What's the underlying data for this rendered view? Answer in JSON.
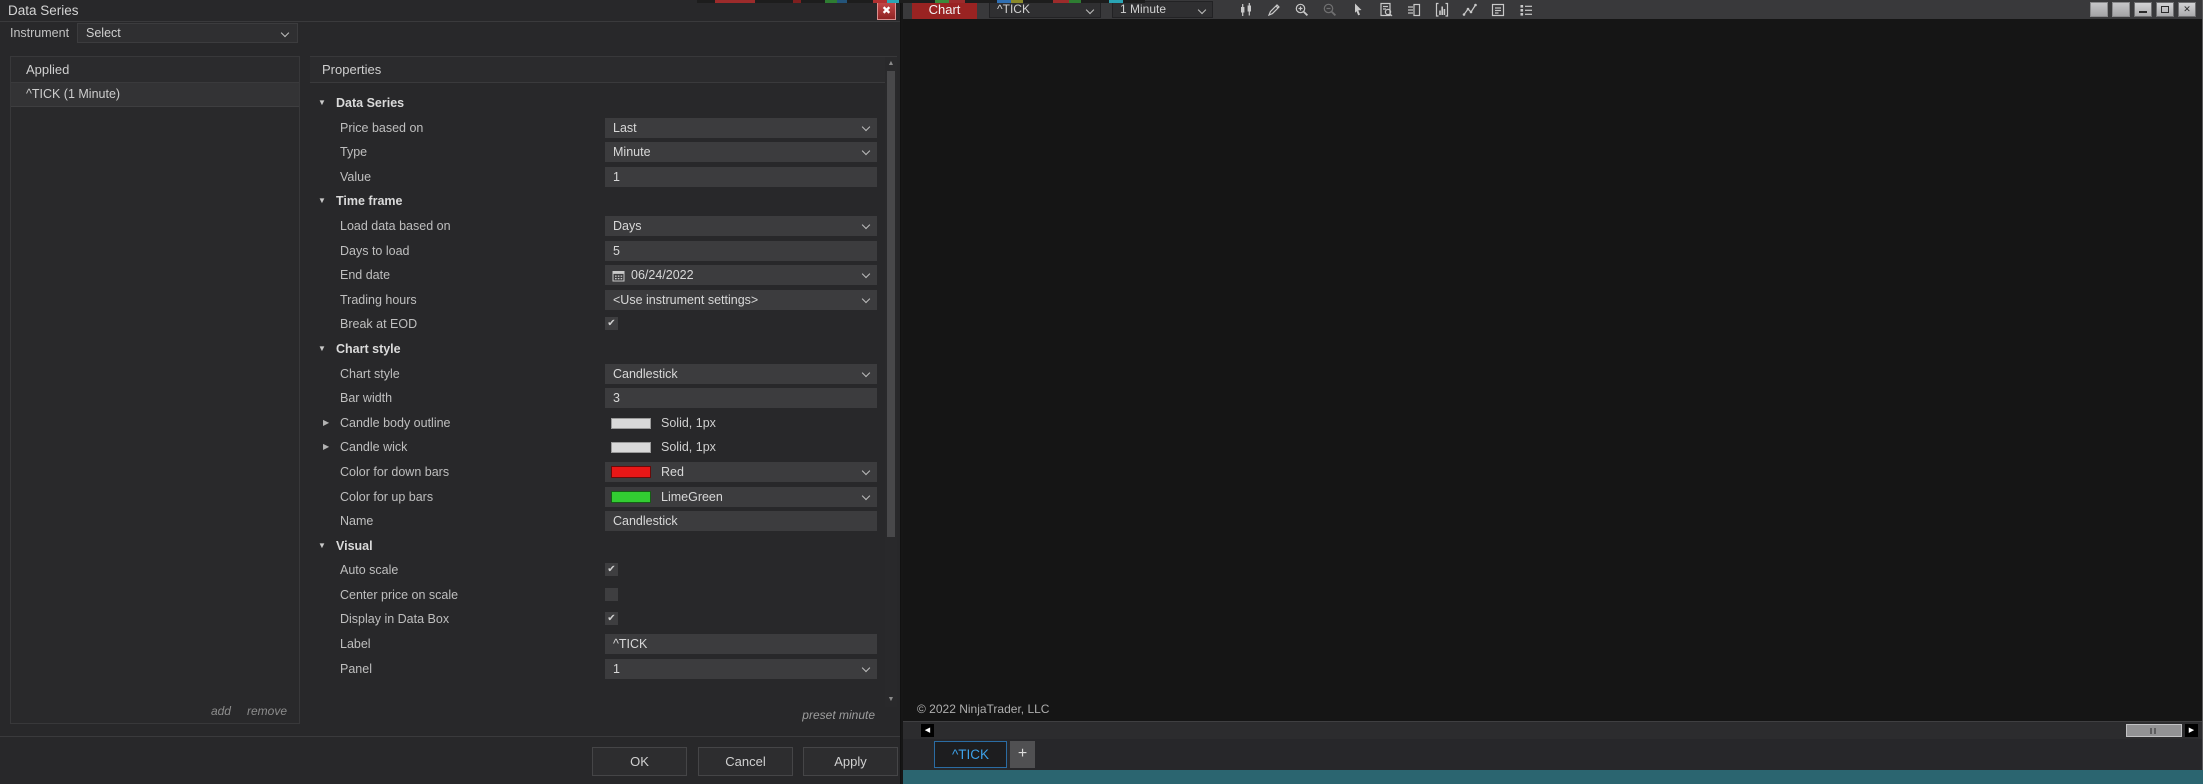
{
  "dialog": {
    "title": "Data Series",
    "instrument_label": "Instrument",
    "instrument_value": "Select",
    "applied": {
      "header": "Applied",
      "items": [
        "^TICK (1 Minute)"
      ],
      "add_label": "add",
      "remove_label": "remove"
    },
    "properties": {
      "header": "Properties",
      "preset_label": "preset minute",
      "rows": [
        {
          "type": "group",
          "label": "Data Series"
        },
        {
          "type": "dropdown",
          "label": "Price based on",
          "value": "Last"
        },
        {
          "type": "dropdown",
          "label": "Type",
          "value": "Minute"
        },
        {
          "type": "input",
          "label": "Value",
          "value": "1"
        },
        {
          "type": "group",
          "label": "Time frame"
        },
        {
          "type": "dropdown",
          "label": "Load data based on",
          "value": "Days"
        },
        {
          "type": "input",
          "label": "Days to load",
          "value": "5"
        },
        {
          "type": "date",
          "label": "End date",
          "value": "06/24/2022"
        },
        {
          "type": "dropdown",
          "label": "Trading hours",
          "value": "<Use instrument settings>"
        },
        {
          "type": "checkbox",
          "label": "Break at EOD",
          "checked": true
        },
        {
          "type": "group",
          "label": "Chart style"
        },
        {
          "type": "dropdown",
          "label": "Chart style",
          "value": "Candlestick"
        },
        {
          "type": "input",
          "label": "Bar width",
          "value": "3"
        },
        {
          "type": "pen",
          "label": "Candle body outline",
          "value": "Solid, 1px",
          "swatch": "#d9d9d9",
          "expandable": true
        },
        {
          "type": "pen",
          "label": "Candle wick",
          "value": "Solid, 1px",
          "swatch": "#d9d9d9",
          "expandable": true
        },
        {
          "type": "color",
          "label": "Color for down bars",
          "value": "Red",
          "swatch": "#e81717"
        },
        {
          "type": "color",
          "label": "Color for up bars",
          "value": "LimeGreen",
          "swatch": "#32cd32"
        },
        {
          "type": "input",
          "label": "Name",
          "value": "Candlestick"
        },
        {
          "type": "group",
          "label": "Visual"
        },
        {
          "type": "checkbox",
          "label": "Auto scale",
          "checked": true
        },
        {
          "type": "checkbox",
          "label": "Center price on scale",
          "checked": false
        },
        {
          "type": "checkbox",
          "label": "Display in Data Box",
          "checked": true
        },
        {
          "type": "input",
          "label": "Label",
          "value": "^TICK"
        },
        {
          "type": "dropdown",
          "label": "Panel",
          "value": "1"
        }
      ]
    },
    "footer_buttons": {
      "ok": "OK",
      "cancel": "Cancel",
      "apply": "Apply"
    }
  },
  "chart": {
    "window_title": "Chart",
    "instrument_value": "^TICK",
    "interval_value": "1 Minute",
    "toolbar_icons": [
      {
        "name": "chart-style"
      },
      {
        "name": "drawing-tools"
      },
      {
        "name": "zoom-in"
      },
      {
        "name": "zoom-out",
        "disabled": true
      },
      {
        "name": "cursor"
      },
      {
        "name": "data-box"
      },
      {
        "name": "chart-trader"
      },
      {
        "name": "indicators"
      },
      {
        "name": "strategies"
      },
      {
        "name": "chart-properties"
      },
      {
        "name": "display-settings"
      }
    ],
    "window_buttons": [
      {
        "name": "instrument-link"
      },
      {
        "name": "interval-link"
      },
      {
        "name": "minimize"
      },
      {
        "name": "maximize"
      },
      {
        "name": "close"
      }
    ],
    "copyright": "© 2022 NinjaTrader, LLC",
    "tabs": [
      {
        "label": "^TICK",
        "active": true
      }
    ],
    "new_tab_label": "+",
    "colors": {
      "title_tab": "#992322",
      "active_tab_text": "#3da0e8",
      "bottom_strip": "#2b6570",
      "down_bar_swatch": "#e81717",
      "up_bar_swatch": "#32cd32"
    }
  }
}
